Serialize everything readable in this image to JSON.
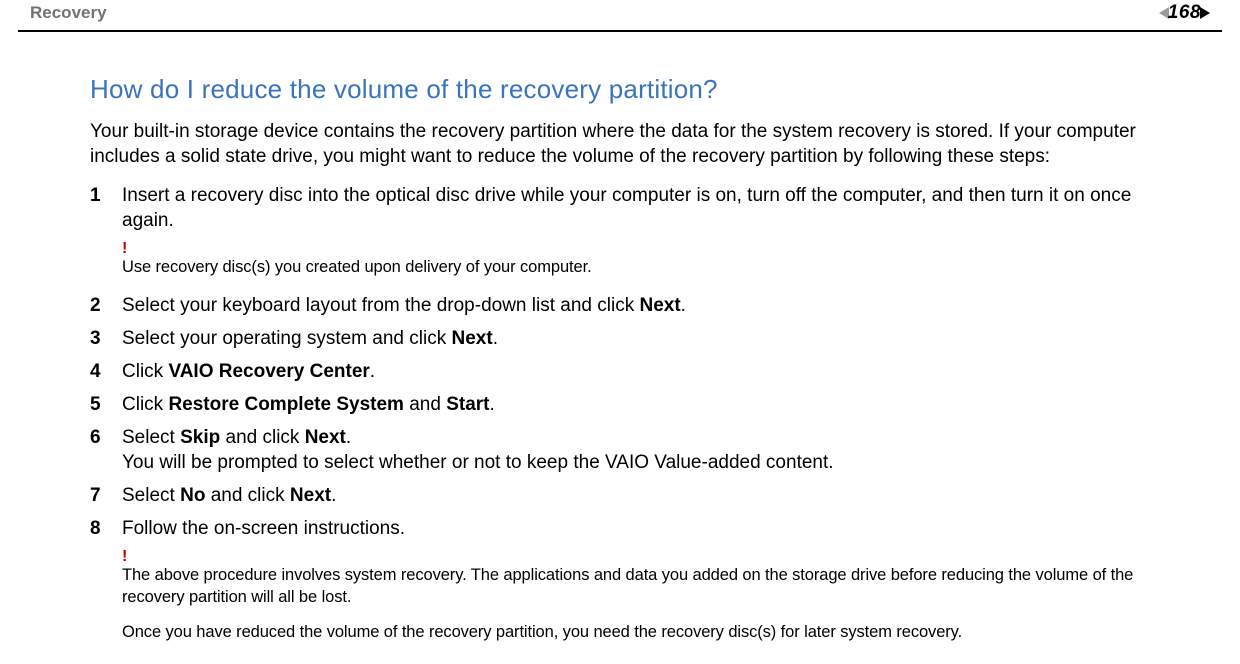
{
  "header": {
    "section": "Recovery",
    "page_number": "168"
  },
  "heading": "How do I reduce the volume of the recovery partition?",
  "intro": "Your built-in storage device contains the recovery partition where the data for the system recovery is stored. If your computer includes a solid state drive, you might want to reduce the volume of the recovery partition by following these steps:",
  "steps": {
    "s1_num": "1",
    "s1_text": "Insert a recovery disc into the optical disc drive while your computer is on, turn off the computer, and then turn it on once again.",
    "s2_num": "2",
    "s2_a": "Select your keyboard layout from the drop-down list and click ",
    "s2_b": "Next",
    "s2_c": ".",
    "s3_num": "3",
    "s3_a": "Select your operating system and click ",
    "s3_b": "Next",
    "s3_c": ".",
    "s4_num": "4",
    "s4_a": "Click ",
    "s4_b": "VAIO Recovery Center",
    "s4_c": ".",
    "s5_num": "5",
    "s5_a": "Click ",
    "s5_b": "Restore Complete System",
    "s5_c": " and ",
    "s5_d": "Start",
    "s5_e": ".",
    "s6_num": "6",
    "s6_a": "Select ",
    "s6_b": "Skip",
    "s6_c": " and click ",
    "s6_d": "Next",
    "s6_e": ".",
    "s6_line2": "You will be prompted to select whether or not to keep the VAIO Value-added content.",
    "s7_num": "7",
    "s7_a": "Select ",
    "s7_b": "No",
    "s7_c": " and click ",
    "s7_d": "Next",
    "s7_e": ".",
    "s8_num": "8",
    "s8_text": "Follow the on-screen instructions."
  },
  "notes": {
    "bang": "!",
    "note1": "Use recovery disc(s) you created upon delivery of your computer.",
    "note2": "The above procedure involves system recovery. The applications and data you added on the storage drive before reducing the volume of the recovery partition will all be lost.",
    "post": "Once you have reduced the volume of the recovery partition, you need the recovery disc(s) for later system recovery."
  }
}
